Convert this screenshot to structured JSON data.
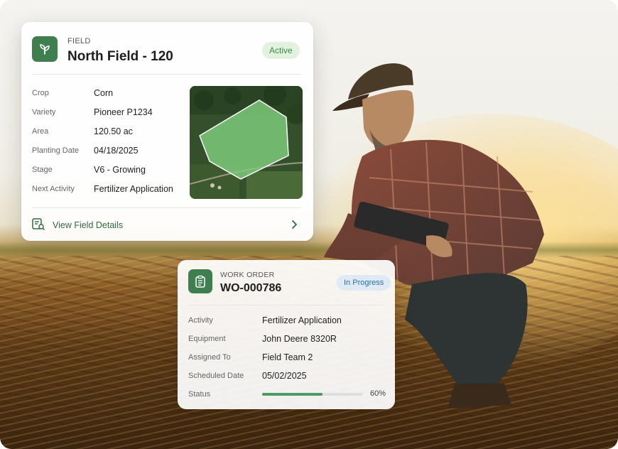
{
  "field_card": {
    "eyebrow": "FIELD",
    "title": "North Field - 120",
    "status": "Active",
    "rows": [
      {
        "label": "Crop",
        "value": "Corn"
      },
      {
        "label": "Variety",
        "value": "Pioneer P1234"
      },
      {
        "label": "Area",
        "value": "120.50 ac"
      },
      {
        "label": "Planting Date",
        "value": "04/18/2025"
      },
      {
        "label": "Stage",
        "value": "V6 - Growing"
      },
      {
        "label": "Next Activity",
        "value": "Fertilizer Application"
      }
    ],
    "link_label": "View Field Details",
    "icons": {
      "badge": "sprout-icon",
      "link": "document-search-icon",
      "chevron": "chevron-right-icon"
    }
  },
  "work_order": {
    "eyebrow": "WORK ORDER",
    "title": "WO-000786",
    "status": "In Progress",
    "rows": [
      {
        "label": "Activity",
        "value": "Fertilizer Application"
      },
      {
        "label": "Equipment",
        "value": "John Deere 8320R"
      },
      {
        "label": "Assigned To",
        "value": "Field Team 2"
      },
      {
        "label": "Scheduled Date",
        "value": "05/02/2025"
      }
    ],
    "status_label": "Status",
    "progress_percent": 60,
    "progress_text": "60%",
    "icons": {
      "badge": "clipboard-icon"
    }
  },
  "colors": {
    "brand_green": "#3f7f4f",
    "active_pill": "#3b8a4a",
    "progress_pill": "#2f6ea8",
    "progress_fill": "#4c9a66"
  }
}
